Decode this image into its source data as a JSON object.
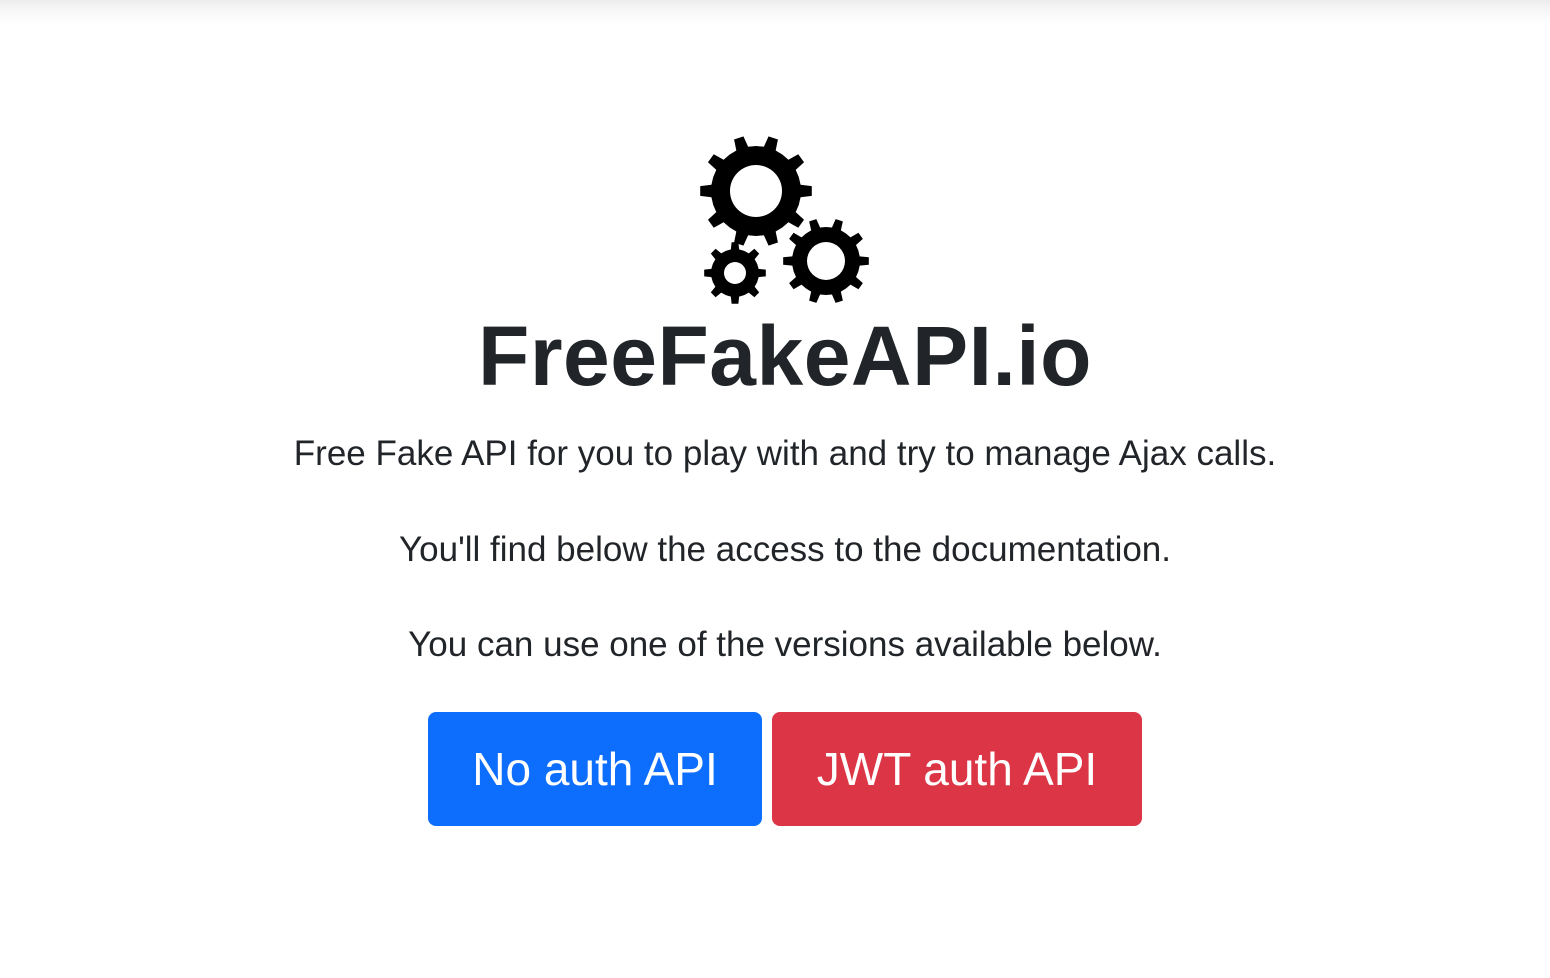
{
  "header": {
    "title": "FreeFakeAPI.io",
    "logo_icon": "gears-icon"
  },
  "intro": {
    "line1": "Free Fake API for you to play with and try to manage Ajax calls.",
    "line2": "You'll find below the access to the documentation.",
    "line3": "You can use one of the versions available below."
  },
  "buttons": {
    "no_auth": {
      "label": "No auth API",
      "color": "#0d6efd"
    },
    "jwt_auth": {
      "label": "JWT auth API",
      "color": "#dc3545"
    }
  }
}
